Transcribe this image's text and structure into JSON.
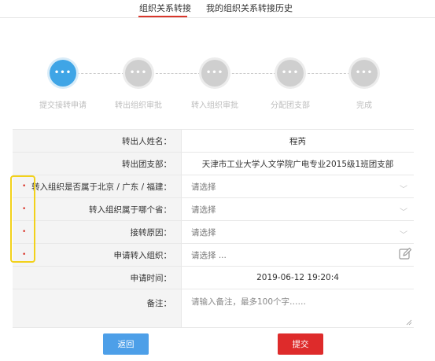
{
  "tabs": [
    {
      "label": "组织关系转接",
      "active": true
    },
    {
      "label": "我的组织关系转接历史",
      "active": false
    }
  ],
  "steps": [
    {
      "label": "提交接转申请",
      "active": true
    },
    {
      "label": "转出组织审批",
      "active": false
    },
    {
      "label": "转入组织审批",
      "active": false
    },
    {
      "label": "分配团支部",
      "active": false
    },
    {
      "label": "完成",
      "active": false
    }
  ],
  "form": {
    "name_label": "转出人姓名：",
    "name_value": "程芮",
    "branch_label": "转出团支部：",
    "branch_value": "天津市工业大学人文学院广电专业2015级1班团支部",
    "region_label": "转入组织是否属于北京 / 广东 / 福建：",
    "region_value": "请选择",
    "province_label": "转入组织属于哪个省：",
    "province_value": "请选择",
    "reason_label": "接转原因：",
    "reason_value": "请选择",
    "target_label": "申请转入组织：",
    "target_value": "请选择 ...",
    "time_label": "申请时间：",
    "time_value": "2019-06-12 19:20:4",
    "note_label": "备注：",
    "note_placeholder": "请输入备注，最多100个字……"
  },
  "buttons": {
    "back": "返回",
    "submit": "提交"
  },
  "colors": {
    "accent_red": "#d9362b",
    "step_active": "#3fa5e6",
    "back_button": "#4d9fe8",
    "submit_button": "#de2b2b",
    "highlight": "#f2d11a"
  }
}
